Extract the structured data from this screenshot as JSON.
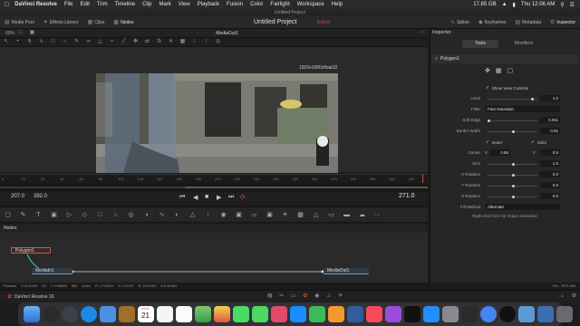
{
  "menubar": {
    "app": "DaVinci Resolve",
    "items": [
      "File",
      "Edit",
      "Trim",
      "Timeline",
      "Clip",
      "Mark",
      "View",
      "Playback",
      "Fusion",
      "Color",
      "Fairlight",
      "Workspace",
      "Help"
    ],
    "disk": "17.85 GB",
    "clock": "Thu 12:06 AM"
  },
  "window": {
    "title": "Untitled Project"
  },
  "tabs": {
    "left": [
      "Media Pool",
      "Effects Library",
      "Clips",
      "Nodes"
    ],
    "project_title": "Untitled Project",
    "project_status": "Edited",
    "right": [
      "Spline",
      "Keyframes",
      "Metadata",
      "Inspector"
    ]
  },
  "viewer": {
    "zoom": "69%",
    "name": "MediaOut1",
    "resolution": "1920x1080xfloat32"
  },
  "ruler": {
    "ticks": [
      "0",
      "10",
      "20",
      "40",
      "60",
      "80",
      "100",
      "120",
      "140",
      "160",
      "180",
      "200",
      "220",
      "240",
      "260",
      "280",
      "300",
      "320",
      "340",
      "360",
      "380",
      "400"
    ]
  },
  "transport": {
    "current": "207.0",
    "end": "392.0",
    "right_tc": "271.0"
  },
  "nodes": {
    "header": "Nodes",
    "polygon": "Polygon1",
    "media_in": "MediaIn1",
    "media_out": "MediaOut1"
  },
  "statusbar": {
    "position_label": "Position",
    "x": "X 0.01194",
    "y": "23",
    "y2": "Y 0.90849",
    "z": "981",
    "color_label": "Color",
    "r": "R -0.01354",
    "g": "G -0.0137",
    "b": "B -0.01201",
    "a": "A 0.18481",
    "mem": "0% - 2571 MB"
  },
  "footer": {
    "app": "DaVinci Resolve 16"
  },
  "inspector": {
    "title": "Inspector",
    "tab_tools": "Tools",
    "tab_modifiers": "Modifiers",
    "node_name": "Polygon1",
    "show_view_controls": "Show View Controls",
    "level_label": "Level",
    "level": "1.0",
    "filter_label": "Filter",
    "filter": "Fast Gaussian",
    "soft_edge_label": "Soft Edge",
    "soft_edge": "0.011",
    "border_width_label": "Border Width",
    "border_width": "0.01",
    "invert": "Invert",
    "solid": "Solid",
    "center_label": "Center",
    "center_x_label": "X",
    "center_x": "0.56",
    "center_y_label": "Y",
    "center_y": "0.5",
    "size_label": "Size",
    "size": "1.0",
    "x_rot_label": "X Rotation",
    "x_rot": "0.0",
    "y_rot_label": "Y Rotation",
    "y_rot": "0.0",
    "z_rot_label": "Z Rotation",
    "z_rot": "0.0",
    "fill_method_label": "Fill Method",
    "fill_method": "Alternate",
    "hint": "Right-click here for shape animation"
  },
  "dock": {
    "calendar_month": "AUG",
    "calendar_day": "21"
  }
}
